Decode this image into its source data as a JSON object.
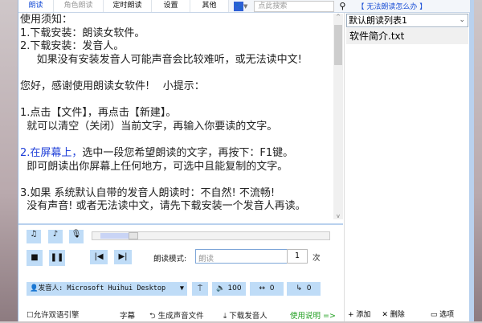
{
  "tabs": [
    "朗读",
    "角色朗读",
    "定时朗读",
    "设置",
    "其他"
  ],
  "search": {
    "placeholder": "点此搜索"
  },
  "help_link": "【 无法朗读怎么办 】",
  "text_lines": [
    "使用须知：",
    "1.下载安装：朗读女软件。",
    "2.下载安装：发音人。",
    "     如果没有安装发音人可能声音会比较难听，或无法读中文!",
    "",
    "您好，感谢使用朗读女软件!    小提示：",
    "",
    "1.点击【文件】，再点击【新建】。",
    "  就可以清空（关闭）当前文字，再输入你要读的文字。",
    ""
  ],
  "blue_part": "2.在屏幕上，",
  "text_lines2": [
    "选中一段您希望朗读的文字，再按下：F1键。",
    "  即可朗读出你屏幕上任何地方，可选中且能复制的文字。",
    "",
    "3.如果 系统默认自带的发音人朗读时：不自然! 不流畅!",
    "  没有声音! 或者无法读中文，请先下载安装一个发音人再读。"
  ],
  "playlist": {
    "selected": "默认朗读列表1",
    "items": [
      "软件简介.txt"
    ],
    "add": "+ 添加",
    "delete": "✕ 删除",
    "options": "▭ 选项"
  },
  "controls": {
    "mode_label": "朗读模式:",
    "mode_value": "朗读",
    "repeat": "1",
    "repeat_unit": "次",
    "voice": "发音人: Microsoft Huihui Desktop",
    "volume": "100",
    "rate": "0",
    "pitch": "0",
    "bilingual": "允许双语引擎",
    "subtitle": "字幕",
    "gen_audio": "生成声音文件",
    "download_voice": "下载发音人",
    "manual": "使用说明 =>"
  }
}
